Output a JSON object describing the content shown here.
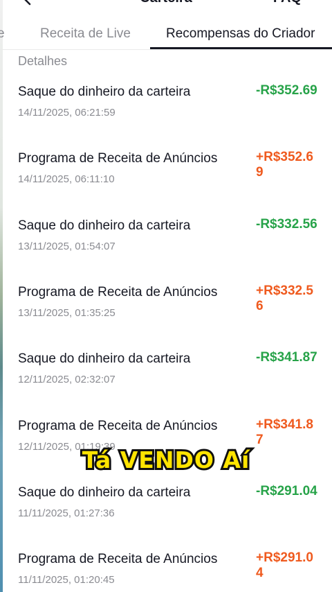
{
  "header": {
    "title": "Carteira",
    "faq": "FAQ"
  },
  "tabs": [
    {
      "label": "e"
    },
    {
      "label": "Receita de Live"
    },
    {
      "label": "Recompensas do Criador"
    }
  ],
  "section": {
    "label": "Detalhes"
  },
  "transactions": [
    {
      "title": "Saque do dinheiro da carteira",
      "date": "14/11/2025, 06:21:59",
      "amount": "-R$352.69",
      "type": "debit"
    },
    {
      "title": "Programa de Receita de Anúncios",
      "date": "14/11/2025, 06:11:10",
      "amount": "+R$352.69",
      "type": "credit"
    },
    {
      "title": "Saque do dinheiro da carteira",
      "date": "13/11/2025, 01:54:07",
      "amount": "-R$332.56",
      "type": "debit"
    },
    {
      "title": "Programa de Receita de Anúncios",
      "date": "13/11/2025, 01:35:25",
      "amount": "+R$332.56",
      "type": "credit"
    },
    {
      "title": "Saque do dinheiro da carteira",
      "date": "12/11/2025, 02:32:07",
      "amount": "-R$341.87",
      "type": "debit"
    },
    {
      "title": "Programa de Receita de Anúncios",
      "date": "12/11/2025, 01:19:39",
      "amount": "+R$341.87",
      "type": "credit"
    },
    {
      "title": "Saque do dinheiro da carteira",
      "date": "11/11/2025, 01:27:36",
      "amount": "-R$291.04",
      "type": "debit"
    },
    {
      "title": "Programa de Receita de Anúncios",
      "date": "11/11/2025, 01:20:45",
      "amount": "+R$291.04",
      "type": "credit"
    }
  ],
  "colors": {
    "debit": "#27a349",
    "credit": "#ef5a1e",
    "caption": "#ffe400"
  },
  "caption": {
    "text": "Tá VENDO Aí"
  }
}
